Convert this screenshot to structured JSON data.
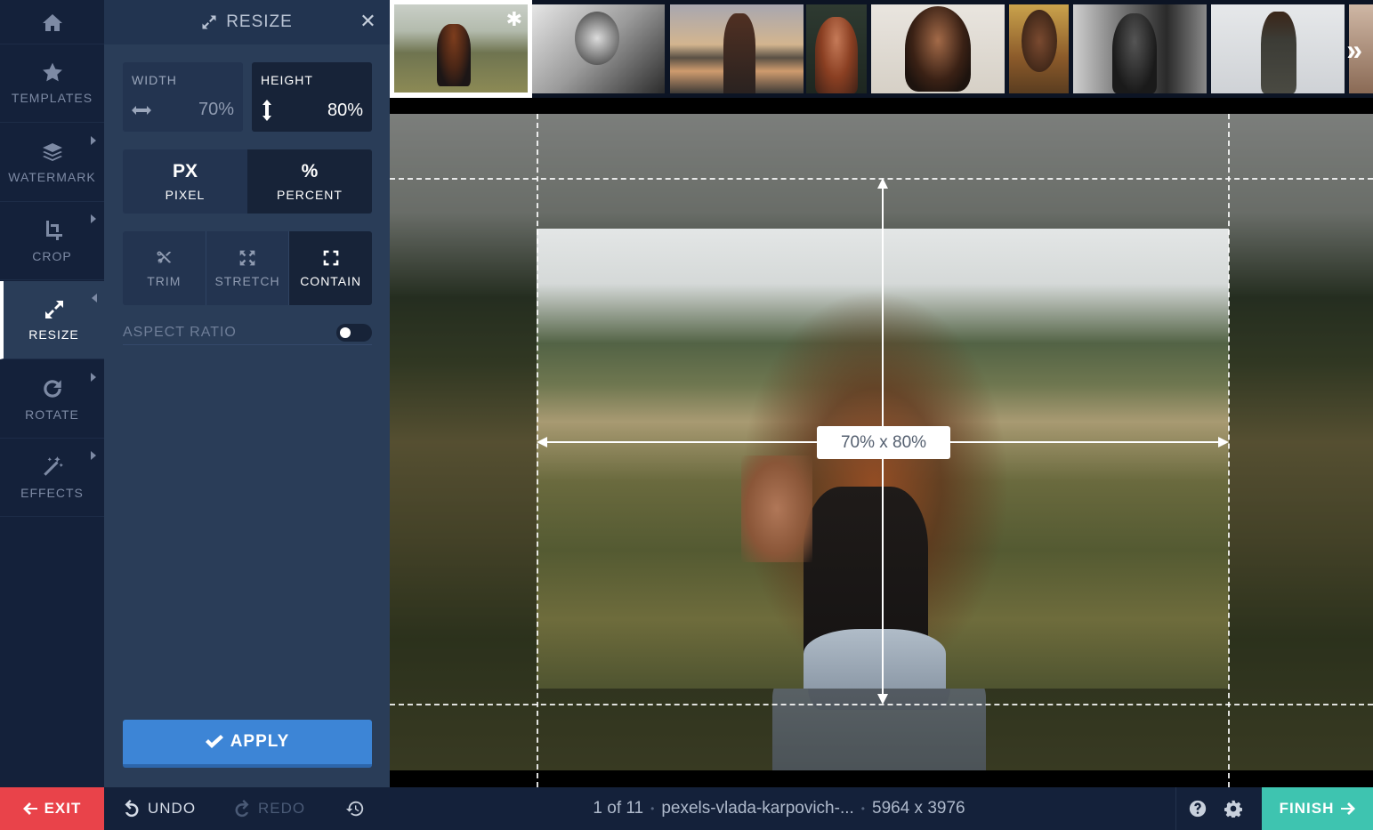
{
  "sidebar": {
    "items": [
      {
        "label": "",
        "icon": "home-icon"
      },
      {
        "label": "TEMPLATES",
        "icon": "star-icon"
      },
      {
        "label": "WATERMARK",
        "icon": "layers-icon"
      },
      {
        "label": "CROP",
        "icon": "crop-icon"
      },
      {
        "label": "RESIZE",
        "icon": "resize-icon"
      },
      {
        "label": "ROTATE",
        "icon": "rotate-icon"
      },
      {
        "label": "EFFECTS",
        "icon": "magic-wand-icon"
      }
    ]
  },
  "panel": {
    "title": "RESIZE",
    "width": {
      "label": "WIDTH",
      "value": "70%"
    },
    "height": {
      "label": "HEIGHT",
      "value": "80%"
    },
    "units": {
      "px": {
        "big": "PX",
        "small": "PIXEL"
      },
      "percent": {
        "big": "%",
        "small": "PERCENT"
      },
      "selected": "PERCENT"
    },
    "modes": {
      "trim": "TRIM",
      "stretch": "STRETCH",
      "contain": "CONTAIN",
      "selected": "CONTAIN"
    },
    "aspect_ratio": {
      "label": "ASPECT RATIO",
      "enabled": false
    },
    "apply_label": "APPLY"
  },
  "canvas": {
    "dims_label": "70% x 80%"
  },
  "bottombar": {
    "exit_label": "EXIT",
    "undo_label": "UNDO",
    "redo_label": "REDO",
    "status": {
      "position": "1 of 11",
      "filename": "pexels-vlada-karpovich-...",
      "resolution": "5964 x 3976"
    },
    "finish_label": "FINISH"
  },
  "colors": {
    "sidebar_bg": "#14213a",
    "panel_bg": "#2a3d58",
    "accent_blue": "#3d85d6",
    "exit_red": "#e9434a",
    "finish_teal": "#3ec4b0"
  }
}
